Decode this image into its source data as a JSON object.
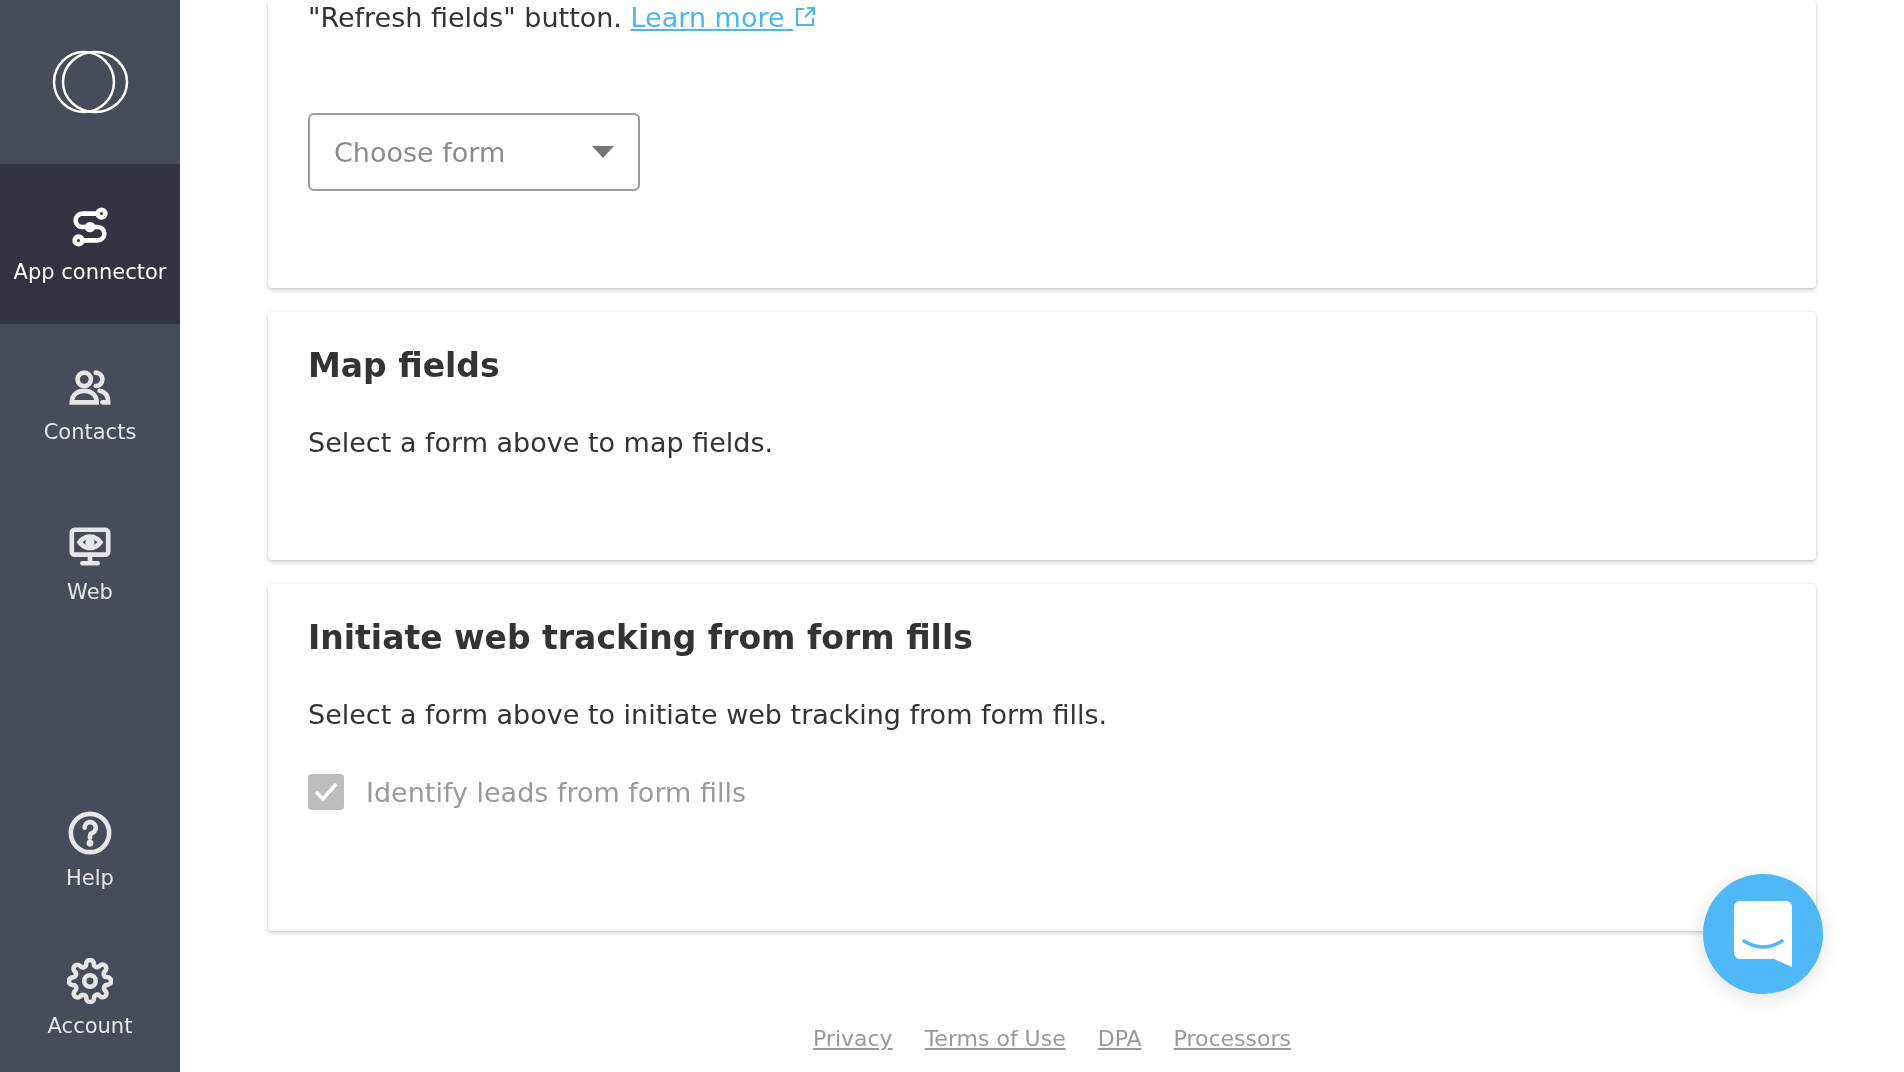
{
  "sidebar": {
    "items": [
      {
        "kind": "connector",
        "label": "App connector",
        "selected": true
      },
      {
        "kind": "contacts",
        "label": "Contacts",
        "selected": false
      },
      {
        "kind": "web",
        "label": "Web",
        "selected": false
      }
    ],
    "bottom_items": [
      {
        "kind": "help",
        "label": "Help",
        "selected": false
      },
      {
        "kind": "account",
        "label": "Account",
        "selected": false
      }
    ]
  },
  "form_card": {
    "text": "\"Refresh fields\" button.",
    "link": "Learn more",
    "dropdown": {
      "placeholder": "Choose form"
    }
  },
  "map_card": {
    "title": "Map fields",
    "text": "Select a form above to map fields."
  },
  "tracking_card": {
    "title": "Initiate web tracking from form fills",
    "text": "Select a form above to initiate web tracking from form fills.",
    "checkbox": {
      "label": "Identify leads from form fills",
      "checked": true,
      "disabled": true
    }
  },
  "footer": {
    "links": [
      "Privacy",
      "Terms of Use",
      "DPA",
      "Processors"
    ]
  }
}
